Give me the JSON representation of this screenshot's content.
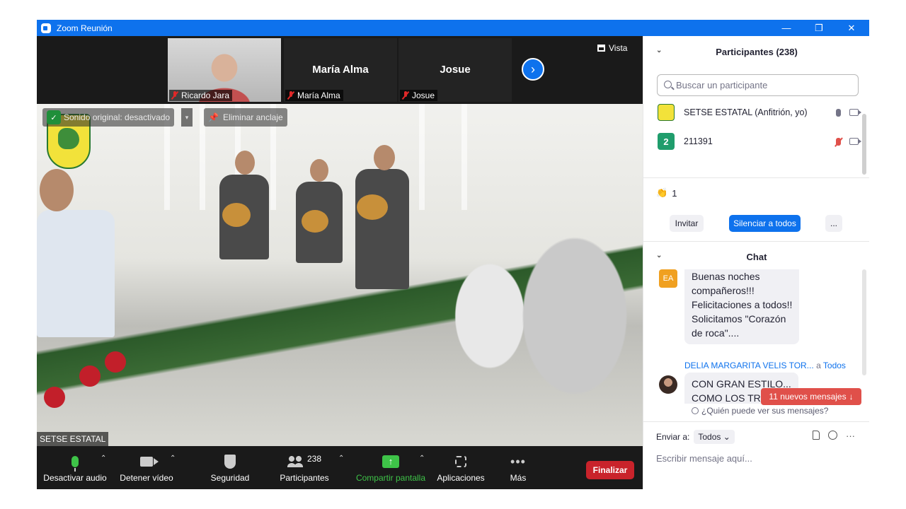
{
  "window": {
    "title": "Zoom Reunión"
  },
  "thumbnails": [
    {
      "name": "Ricardo Jara",
      "has_video": true
    },
    {
      "name": "María Alma",
      "has_video": false
    },
    {
      "name": "Josue",
      "has_video": false
    }
  ],
  "view_button": "Vista",
  "main_video": {
    "original_sound": "Sonido original: desactivado",
    "unpin": "Eliminar anclaje",
    "speaker_label": "SETSE ESTATAL"
  },
  "toolbar": {
    "mute": "Desactivar audio",
    "stop_video": "Detener vídeo",
    "security": "Seguridad",
    "participants": "Participantes",
    "participants_count": "238",
    "share": "Compartir pantalla",
    "apps": "Aplicaciones",
    "more": "Más",
    "end": "Finalizar"
  },
  "participants_panel": {
    "title": "Participantes (238)",
    "search_placeholder": "Buscar un participante",
    "list": [
      {
        "name": "SETSE ESTATAL (Anfitrión, yo)",
        "avatar": "logo"
      },
      {
        "name": "211391",
        "avatar": "2",
        "avatar_color": "#1f9d6c"
      }
    ],
    "reaction_count": "1",
    "invite": "Invitar",
    "mute_all": "Silenciar a todos",
    "more": "..."
  },
  "chat": {
    "title": "Chat",
    "messages": [
      {
        "avatar": "EA",
        "avatar_color": "#f0a020",
        "text_lines": [
          "Buenas noches",
          "compañeros!!!",
          "Felicitaciones a todos!!",
          "Solicitamos \"Corazón",
          "de roca\"...."
        ]
      },
      {
        "sender": "DELIA MARGARITA VELIS TOR...",
        "to_word": "a",
        "to": "Todos",
        "text_lines": [
          "CON GRAN ESTILO...",
          "COMO LOS TRES"
        ]
      }
    ],
    "new_messages": "11 nuevos mensajes",
    "who_can_see": "¿Quién puede ver sus mensajes?",
    "send_to_label": "Enviar a:",
    "send_to_value": "Todos",
    "input_placeholder": "Escribir mensaje aquí..."
  },
  "colors": {
    "accent": "#0e72ed",
    "end": "#c9232b",
    "share": "#3ec348",
    "alert": "#e0504a"
  }
}
